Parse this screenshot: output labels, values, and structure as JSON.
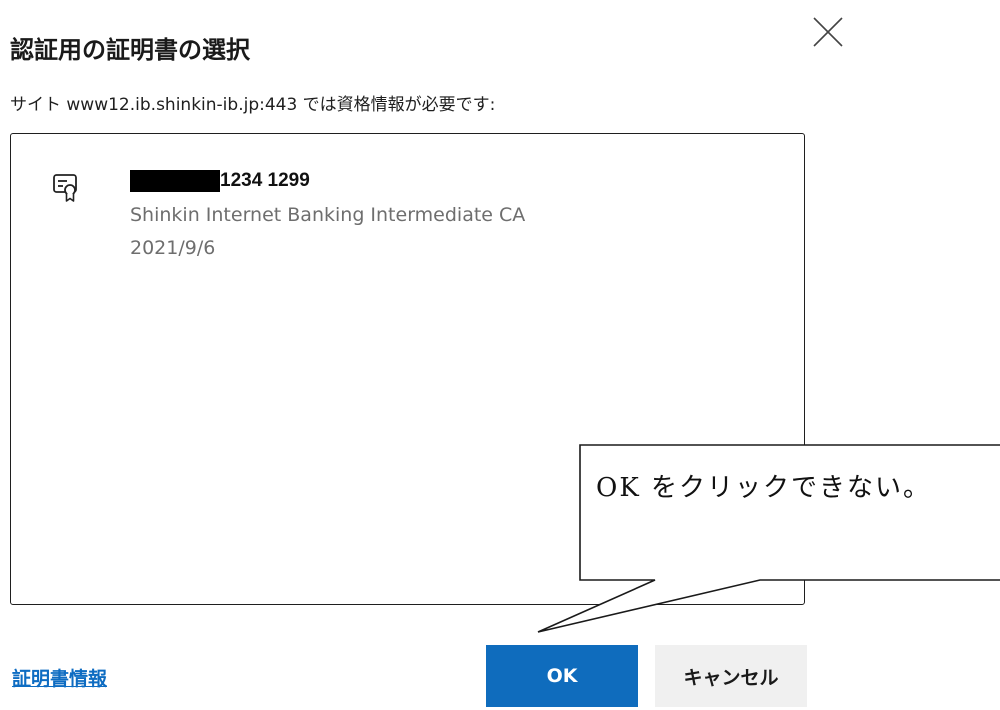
{
  "dialog": {
    "title": "認証用の証明書の選択",
    "subtitle": "サイト www12.ib.shinkin-ib.jp:443 では資格情報が必要です:",
    "close_icon": "close-icon"
  },
  "certificates": [
    {
      "name_visible": "1234 1299",
      "name_redacted": true,
      "issuer": "Shinkin Internet Banking Intermediate CA",
      "date": "2021/9/6",
      "icon": "certificate-icon"
    }
  ],
  "footer": {
    "cert_info_link": "証明書情報",
    "ok_label": "OK",
    "cancel_label": "キャンセル"
  },
  "annotation": {
    "callout_text": "OK をクリックできない。"
  },
  "colors": {
    "ok_button_bg": "#0f6cbd",
    "cancel_button_bg": "#f0f0f0",
    "link": "#0e6cc2",
    "secondary_text": "#6e6e6e",
    "redaction": "#000000"
  }
}
